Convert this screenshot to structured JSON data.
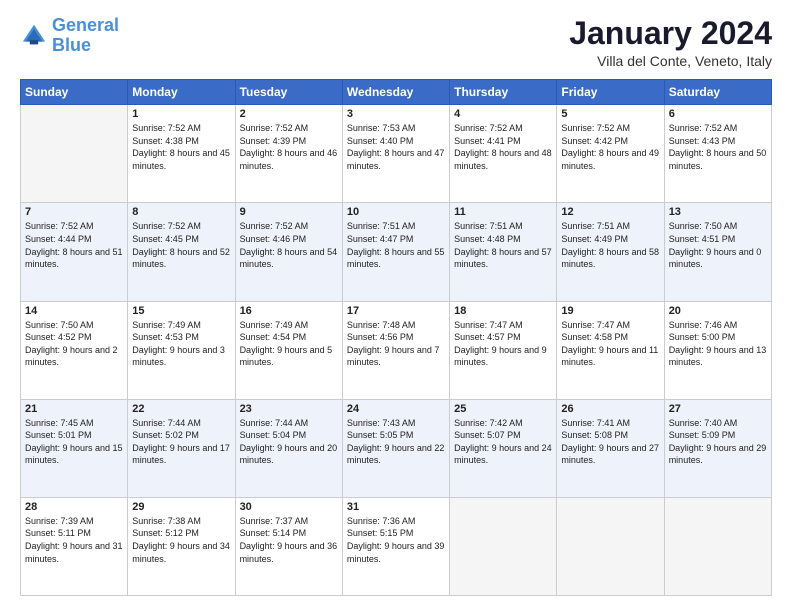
{
  "logo": {
    "line1": "General",
    "line2": "Blue"
  },
  "title": "January 2024",
  "subtitle": "Villa del Conte, Veneto, Italy",
  "weekdays": [
    "Sunday",
    "Monday",
    "Tuesday",
    "Wednesday",
    "Thursday",
    "Friday",
    "Saturday"
  ],
  "weeks": [
    [
      {
        "day": "",
        "sunrise": "",
        "sunset": "",
        "daylight": ""
      },
      {
        "day": "1",
        "sunrise": "Sunrise: 7:52 AM",
        "sunset": "Sunset: 4:38 PM",
        "daylight": "Daylight: 8 hours and 45 minutes."
      },
      {
        "day": "2",
        "sunrise": "Sunrise: 7:52 AM",
        "sunset": "Sunset: 4:39 PM",
        "daylight": "Daylight: 8 hours and 46 minutes."
      },
      {
        "day": "3",
        "sunrise": "Sunrise: 7:53 AM",
        "sunset": "Sunset: 4:40 PM",
        "daylight": "Daylight: 8 hours and 47 minutes."
      },
      {
        "day": "4",
        "sunrise": "Sunrise: 7:52 AM",
        "sunset": "Sunset: 4:41 PM",
        "daylight": "Daylight: 8 hours and 48 minutes."
      },
      {
        "day": "5",
        "sunrise": "Sunrise: 7:52 AM",
        "sunset": "Sunset: 4:42 PM",
        "daylight": "Daylight: 8 hours and 49 minutes."
      },
      {
        "day": "6",
        "sunrise": "Sunrise: 7:52 AM",
        "sunset": "Sunset: 4:43 PM",
        "daylight": "Daylight: 8 hours and 50 minutes."
      }
    ],
    [
      {
        "day": "7",
        "sunrise": "Sunrise: 7:52 AM",
        "sunset": "Sunset: 4:44 PM",
        "daylight": "Daylight: 8 hours and 51 minutes."
      },
      {
        "day": "8",
        "sunrise": "Sunrise: 7:52 AM",
        "sunset": "Sunset: 4:45 PM",
        "daylight": "Daylight: 8 hours and 52 minutes."
      },
      {
        "day": "9",
        "sunrise": "Sunrise: 7:52 AM",
        "sunset": "Sunset: 4:46 PM",
        "daylight": "Daylight: 8 hours and 54 minutes."
      },
      {
        "day": "10",
        "sunrise": "Sunrise: 7:51 AM",
        "sunset": "Sunset: 4:47 PM",
        "daylight": "Daylight: 8 hours and 55 minutes."
      },
      {
        "day": "11",
        "sunrise": "Sunrise: 7:51 AM",
        "sunset": "Sunset: 4:48 PM",
        "daylight": "Daylight: 8 hours and 57 minutes."
      },
      {
        "day": "12",
        "sunrise": "Sunrise: 7:51 AM",
        "sunset": "Sunset: 4:49 PM",
        "daylight": "Daylight: 8 hours and 58 minutes."
      },
      {
        "day": "13",
        "sunrise": "Sunrise: 7:50 AM",
        "sunset": "Sunset: 4:51 PM",
        "daylight": "Daylight: 9 hours and 0 minutes."
      }
    ],
    [
      {
        "day": "14",
        "sunrise": "Sunrise: 7:50 AM",
        "sunset": "Sunset: 4:52 PM",
        "daylight": "Daylight: 9 hours and 2 minutes."
      },
      {
        "day": "15",
        "sunrise": "Sunrise: 7:49 AM",
        "sunset": "Sunset: 4:53 PM",
        "daylight": "Daylight: 9 hours and 3 minutes."
      },
      {
        "day": "16",
        "sunrise": "Sunrise: 7:49 AM",
        "sunset": "Sunset: 4:54 PM",
        "daylight": "Daylight: 9 hours and 5 minutes."
      },
      {
        "day": "17",
        "sunrise": "Sunrise: 7:48 AM",
        "sunset": "Sunset: 4:56 PM",
        "daylight": "Daylight: 9 hours and 7 minutes."
      },
      {
        "day": "18",
        "sunrise": "Sunrise: 7:47 AM",
        "sunset": "Sunset: 4:57 PM",
        "daylight": "Daylight: 9 hours and 9 minutes."
      },
      {
        "day": "19",
        "sunrise": "Sunrise: 7:47 AM",
        "sunset": "Sunset: 4:58 PM",
        "daylight": "Daylight: 9 hours and 11 minutes."
      },
      {
        "day": "20",
        "sunrise": "Sunrise: 7:46 AM",
        "sunset": "Sunset: 5:00 PM",
        "daylight": "Daylight: 9 hours and 13 minutes."
      }
    ],
    [
      {
        "day": "21",
        "sunrise": "Sunrise: 7:45 AM",
        "sunset": "Sunset: 5:01 PM",
        "daylight": "Daylight: 9 hours and 15 minutes."
      },
      {
        "day": "22",
        "sunrise": "Sunrise: 7:44 AM",
        "sunset": "Sunset: 5:02 PM",
        "daylight": "Daylight: 9 hours and 17 minutes."
      },
      {
        "day": "23",
        "sunrise": "Sunrise: 7:44 AM",
        "sunset": "Sunset: 5:04 PM",
        "daylight": "Daylight: 9 hours and 20 minutes."
      },
      {
        "day": "24",
        "sunrise": "Sunrise: 7:43 AM",
        "sunset": "Sunset: 5:05 PM",
        "daylight": "Daylight: 9 hours and 22 minutes."
      },
      {
        "day": "25",
        "sunrise": "Sunrise: 7:42 AM",
        "sunset": "Sunset: 5:07 PM",
        "daylight": "Daylight: 9 hours and 24 minutes."
      },
      {
        "day": "26",
        "sunrise": "Sunrise: 7:41 AM",
        "sunset": "Sunset: 5:08 PM",
        "daylight": "Daylight: 9 hours and 27 minutes."
      },
      {
        "day": "27",
        "sunrise": "Sunrise: 7:40 AM",
        "sunset": "Sunset: 5:09 PM",
        "daylight": "Daylight: 9 hours and 29 minutes."
      }
    ],
    [
      {
        "day": "28",
        "sunrise": "Sunrise: 7:39 AM",
        "sunset": "Sunset: 5:11 PM",
        "daylight": "Daylight: 9 hours and 31 minutes."
      },
      {
        "day": "29",
        "sunrise": "Sunrise: 7:38 AM",
        "sunset": "Sunset: 5:12 PM",
        "daylight": "Daylight: 9 hours and 34 minutes."
      },
      {
        "day": "30",
        "sunrise": "Sunrise: 7:37 AM",
        "sunset": "Sunset: 5:14 PM",
        "daylight": "Daylight: 9 hours and 36 minutes."
      },
      {
        "day": "31",
        "sunrise": "Sunrise: 7:36 AM",
        "sunset": "Sunset: 5:15 PM",
        "daylight": "Daylight: 9 hours and 39 minutes."
      },
      {
        "day": "",
        "sunrise": "",
        "sunset": "",
        "daylight": ""
      },
      {
        "day": "",
        "sunrise": "",
        "sunset": "",
        "daylight": ""
      },
      {
        "day": "",
        "sunrise": "",
        "sunset": "",
        "daylight": ""
      }
    ]
  ]
}
